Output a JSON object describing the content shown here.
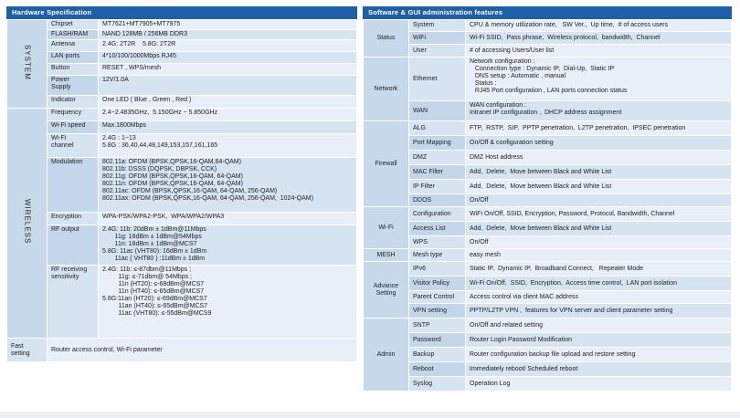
{
  "hardware": {
    "title": "Hardware Specification",
    "system_label": "SYSTEM",
    "wireless_label": "WIRELESS",
    "system_rows": [
      {
        "k": "Chipset",
        "v": "MT7621+MT7905+MT7975"
      },
      {
        "k": "FLASH/RAM",
        "v": "NAND 128MB / 256MB DDR3"
      },
      {
        "k": "Antenna",
        "v": "2.4G: 2T2R    5.8G: 2T2R"
      },
      {
        "k": "LAN ports",
        "v": "4*10/100/1000Mbps RJ45"
      },
      {
        "k": "Button",
        "v": "RESET , WPS/mesh"
      },
      {
        "k": "Power\nSupply",
        "v": "12V/1.0A"
      },
      {
        "k": "Indicator",
        "v": "One LED ( Blue , Green , Red )"
      }
    ],
    "wireless_rows": [
      {
        "k": "Frequency",
        "v": "2.4~2.4835GHz,  5.150GHz ~ 5.850GHz"
      },
      {
        "k": "Wi-Fi speed",
        "v": "Max.1800Mbps"
      },
      {
        "k": "Wi-Fi\nchannel",
        "v": "2.4G : 1~13\n5.8G : 36,40,44,48,149,153,157,161,165"
      },
      {
        "k": "Modulation",
        "v": "802.11a: OFDM (BPSK,QPSK,16-QAM,64-QAM)\n802.11b: DSSS (DQPSK, DBPSK, CCK)\n802.11g: OFDM (BPSK,QPSK,16-QAM, 64-QAM)\n802.11n: OFDM (BPSK,QPSK,16-QAM, 64-QAM)\n802.11ac: OFDM (BPSK,QPSK,16-QAM, 64-QAM, 256-QAM)\n802.11ax: OFDM (BPSK,QPSK,16-QAM, 64-QAM, 256-QAM,  1024-QAM)"
      },
      {
        "k": "Encryption",
        "v": "WPA-PSK/WPA2-PSK,  WPA/WPA2/WPA3"
      },
      {
        "k": "RF output",
        "v": "2.4G: 11b: 20dBm ± 1dBm@11Mbps\n       11g: 18dBm ± 1dBm@54Mbps\n       11n: 18dBm ± 1dBm@MCS7\n5.8G: 11ac (VHT80): 16dBm ± 1dBm\n       11ac ( VHT80 ) :11dBm ± 1dBm"
      },
      {
        "k": "RF receiving\nsensitivity",
        "v": "2.4G: 11b: ≤-87dbm@11Mbps ;\n         11g: ≤-71dbm@ 54Mbps ;\n         11n (HT20): ≤-68dBm@MCS7\n         11n (HT40): ≤-65dBm@MCS7\n5.8G:11an (HT20): ≤-69dBm@MCS7\n         11an (HT40): ≤-65dBm@MCS7\n         11ac (VHT80): ≤-55dBm@MCS9"
      }
    ],
    "fast": {
      "cat": "Fast\nsetting",
      "v": "Router access control, Wi-Fi parameter"
    }
  },
  "software": {
    "title": "Software & GUI administration features",
    "groups": [
      {
        "cat": "Status",
        "rows": [
          {
            "k": "System",
            "v": "CPU & memory utilization rate,   SW Ver.,  Up time,  # of access users"
          },
          {
            "k": "WiFi",
            "v": "Wi-Fi SSID,  Pass phrase,  Wireless protocol,  bandwidth,  Channel"
          },
          {
            "k": "User",
            "v": "# of accessing Users/User list"
          }
        ]
      },
      {
        "cat": "Network",
        "rows": [
          {
            "k": "Ethernet",
            "v": "Network configuration :\n   Connection type : Dynamic IP,  Dial-Up,  Static IP\n   DNS setup : Automatic , manual\n   Status :\n   RJ45 Port configuration , LAN ports connection status"
          },
          {
            "k": "WAN",
            "v": "WAN configuration :\nIntranet IP configuration ,  DHCP address assignment"
          }
        ]
      },
      {
        "cat": "Firewall",
        "rows": [
          {
            "k": "ALG",
            "v": "FTP,  RSTP,  SIP,  PPTP penetration,  L2TP penetration,  IPSEC penetration"
          },
          {
            "k": "Port Mapping",
            "v": "On/Off & configuration setting"
          },
          {
            "k": "DMZ",
            "v": "DMZ Host address"
          },
          {
            "k": "MAC Filter",
            "v": "Add,  Delete,  Move between Black and White List"
          },
          {
            "k": "IP Filter",
            "v": "Add,  Delete,  Move between Black and White List"
          },
          {
            "k": "DDOS",
            "v": "On/Off"
          }
        ]
      },
      {
        "cat": "Wi-Fi",
        "rows": [
          {
            "k": "Configuration",
            "v": "WiFi On/Off, SSID, Encryption, Password, Protocol, Bandwidth, Channel"
          },
          {
            "k": "Access List",
            "v": "Add,  Delete,  Move between Black and White List"
          },
          {
            "k": "WPS",
            "v": "On/Off"
          }
        ]
      },
      {
        "cat": "MESH",
        "rows": [
          {
            "k": "Mesh type",
            "v": "easy mesh"
          }
        ]
      },
      {
        "cat": "Advance\nSetting",
        "rows": [
          {
            "k": "IPv6",
            "v": "Static IP,  Dynamic IP,  Broadband Connect,   Repeater Mode"
          },
          {
            "k": "Visitor Policy",
            "v": "Wi-Fi On/Off,  SSID,  Encryption,  Access time control,  LAN port isolation"
          },
          {
            "k": "Parent Control",
            "v": "Access control via client MAC address"
          },
          {
            "k": "VPN setting",
            "v": "PPTP/L2TP VPN ,  features for VPN server and client parameter setting"
          }
        ]
      },
      {
        "cat": "Admin",
        "rows": [
          {
            "k": "SNTP",
            "v": "On/Off and related setting"
          },
          {
            "k": "Password",
            "v": "Router Login Password Modification"
          },
          {
            "k": "Backup",
            "v": "Router configuration backup file upload and restore setting"
          },
          {
            "k": "Reboot",
            "v": "Immediately reboot/ Scheduled reboot"
          },
          {
            "k": "Syslog",
            "v": "Operation Log"
          }
        ]
      }
    ]
  }
}
